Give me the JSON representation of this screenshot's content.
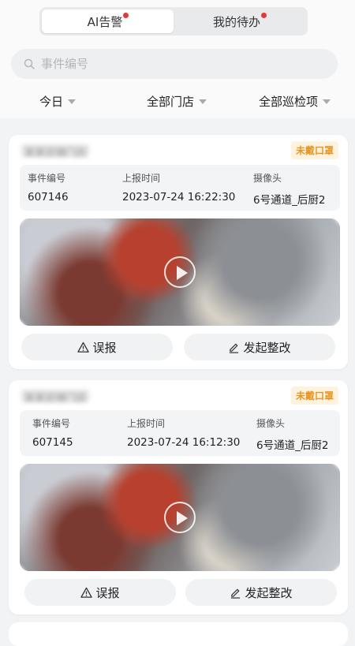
{
  "tabs": [
    {
      "label": "AI告警",
      "active": true,
      "has_dot": true
    },
    {
      "label": "我的待办",
      "active": false,
      "has_dot": true
    }
  ],
  "search": {
    "placeholder": "事件编号"
  },
  "filters": [
    {
      "label": "今日"
    },
    {
      "label": "全部门店"
    },
    {
      "label": "全部巡检项"
    }
  ],
  "field_labels": {
    "event_id": "事件编号",
    "report_time": "上报时间",
    "camera": "摄像头"
  },
  "actions": {
    "false_alarm": "误报",
    "rectify": "发起整改"
  },
  "cards": [
    {
      "store_name": "某某店铺门店",
      "status_badge": "未戴口罩",
      "event_id": "607146",
      "report_time": "2023-07-24 16:22:30",
      "camera": "6号通道_后厨2"
    },
    {
      "store_name": "某某店铺门店",
      "status_badge": "未戴口罩",
      "event_id": "607145",
      "report_time": "2023-07-24 16:12:30",
      "camera": "6号通道_后厨2"
    }
  ],
  "colors": {
    "badge_text": "#e69522",
    "badge_bg": "#fff3df",
    "notify_dot": "#e23a3a"
  }
}
